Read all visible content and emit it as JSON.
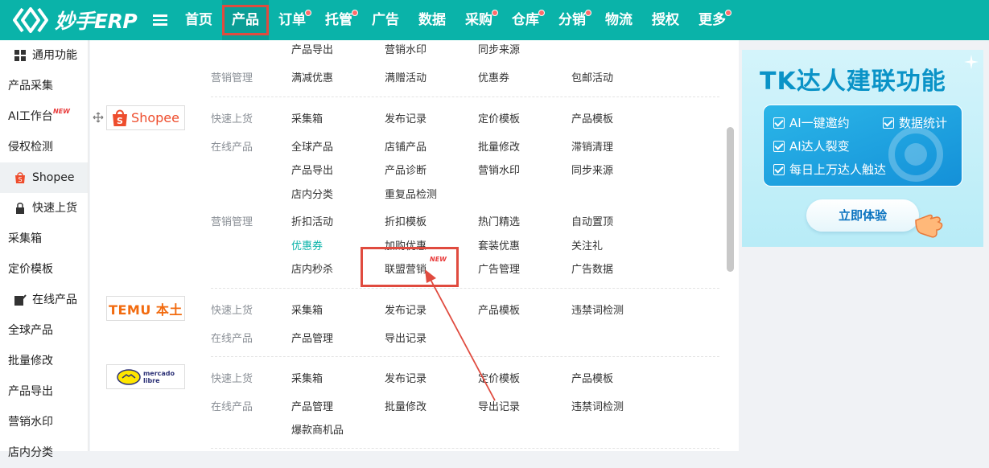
{
  "app": {
    "logo_text": "妙手ERP"
  },
  "nav": [
    {
      "label": "首页",
      "dot": false,
      "active": false
    },
    {
      "label": "产品",
      "dot": false,
      "active": true
    },
    {
      "label": "订单",
      "dot": true,
      "active": false
    },
    {
      "label": "托管",
      "dot": true,
      "active": false
    },
    {
      "label": "广告",
      "dot": false,
      "active": false
    },
    {
      "label": "数据",
      "dot": false,
      "active": false
    },
    {
      "label": "采购",
      "dot": true,
      "active": false
    },
    {
      "label": "仓库",
      "dot": true,
      "active": false
    },
    {
      "label": "分销",
      "dot": true,
      "active": false
    },
    {
      "label": "物流",
      "dot": false,
      "active": false
    },
    {
      "label": "授权",
      "dot": false,
      "active": false
    },
    {
      "label": "更多",
      "dot": true,
      "active": false
    }
  ],
  "sidebar": {
    "general": "通用功能",
    "items": [
      "产品采集",
      "AI工作台",
      "侵权检测",
      "Shopee",
      "快速上货",
      "采集箱",
      "定价模板",
      "在线产品",
      "全球产品",
      "批量修改",
      "产品导出",
      "营销水印",
      "店内分类"
    ],
    "new_tag": "NEW"
  },
  "panel": {
    "top": {
      "row0": [
        "产品导出",
        "营销水印",
        "同步来源"
      ],
      "marketing_label": "营销管理",
      "row1": [
        "满减优惠",
        "满赠活动",
        "优惠券",
        "包邮活动"
      ]
    },
    "shopee": {
      "logo": "Shopee",
      "quick_label": "快速上货",
      "quick": [
        "采集箱",
        "发布记录",
        "定价模板",
        "产品模板"
      ],
      "online_label": "在线产品",
      "online": [
        "全球产品",
        "店铺产品",
        "批量修改",
        "滞销清理",
        "产品导出",
        "产品诊断",
        "营销水印",
        "同步来源",
        "店内分类",
        "重复品检测"
      ],
      "marketing_label": "营销管理",
      "marketing": [
        "折扣活动",
        "折扣模板",
        "热门精选",
        "自动置顶",
        "优惠券",
        "加购优惠",
        "套装优惠",
        "关注礼",
        "店内秒杀",
        "联盟营销",
        "广告管理",
        "广告数据"
      ],
      "new_tag": "NEW"
    },
    "temu": {
      "logo": "TEMU 本土",
      "quick_label": "快速上货",
      "quick": [
        "采集箱",
        "发布记录",
        "产品模板",
        "违禁词检测"
      ],
      "online_label": "在线产品",
      "online": [
        "产品管理",
        "导出记录"
      ]
    },
    "mercado": {
      "logo_line1": "mercado",
      "logo_line2": "libre",
      "quick_label": "快速上货",
      "quick": [
        "采集箱",
        "发布记录",
        "定价模板",
        "产品模板"
      ],
      "online_label": "在线产品",
      "online": [
        "产品管理",
        "批量修改",
        "导出记录",
        "违禁词检测",
        "爆款商机品"
      ]
    }
  },
  "ad": {
    "title": "TK达人建联功能",
    "features": [
      "AI一键邀约",
      "数据统计",
      "AI达人裂变",
      "每日上万达人触达"
    ],
    "button": "立即体验"
  },
  "colors": {
    "brand": "#0ab3a9",
    "annotation": "#e04b3f",
    "accent_link": "#0ab3a9"
  }
}
